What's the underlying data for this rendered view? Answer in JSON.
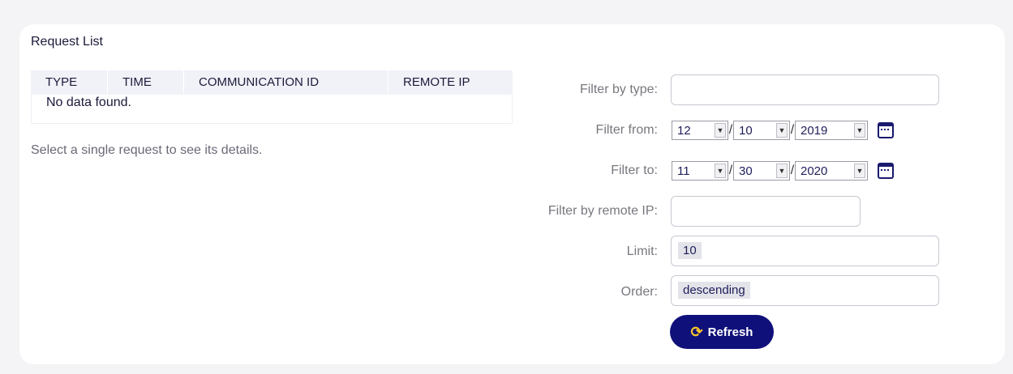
{
  "panel": {
    "title": "Request List"
  },
  "table": {
    "columns": [
      "TYPE",
      "TIME",
      "COMMUNICATION ID",
      "REMOTE IP"
    ],
    "empty_message": "No data found."
  },
  "hint": "Select a single request to see its details.",
  "filters": {
    "type_label": "Filter by type:",
    "type_value": "",
    "from_label": "Filter from:",
    "from_month": "12",
    "from_day": "10",
    "from_year": "2019",
    "to_label": "Filter to:",
    "to_month": "11",
    "to_day": "30",
    "to_year": "2020",
    "ip_label": "Filter by remote IP:",
    "ip_value": "",
    "limit_label": "Limit:",
    "limit_value": "10",
    "order_label": "Order:",
    "order_value": "descending"
  },
  "buttons": {
    "refresh_label": "Refresh",
    "refresh_icon": "refresh-icon"
  },
  "colors": {
    "accent": "#10107a",
    "icon_accent": "#f7c52b"
  }
}
